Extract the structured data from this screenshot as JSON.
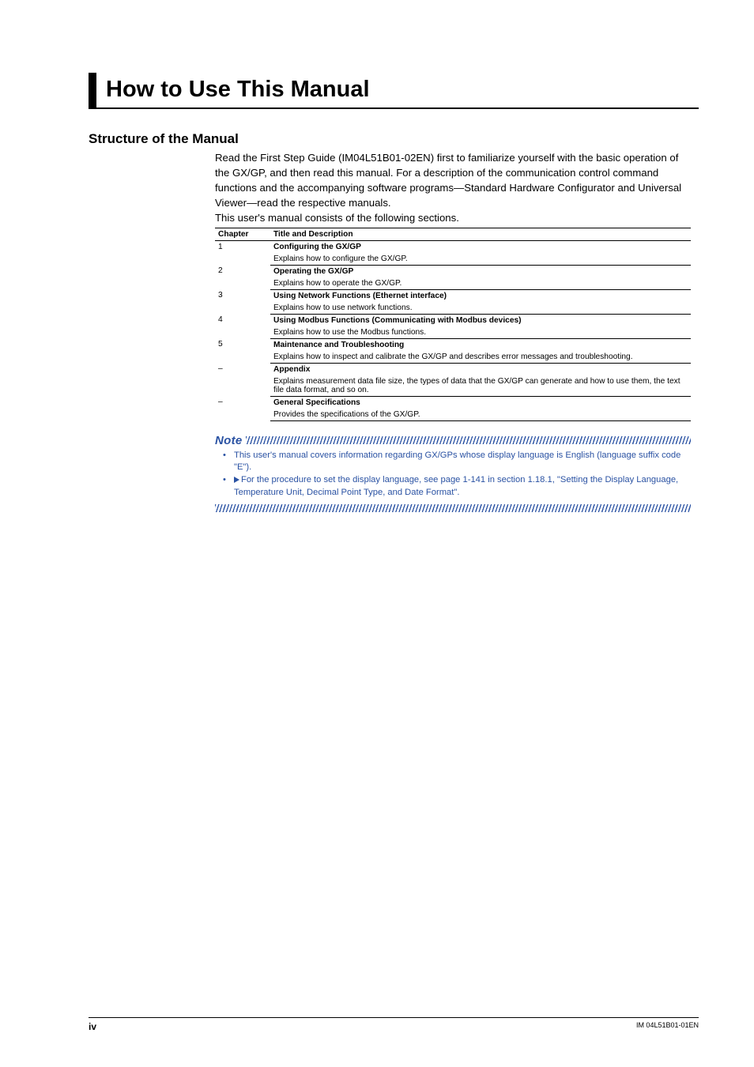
{
  "title": "How to Use This Manual",
  "section_heading": "Structure of the Manual",
  "intro": "Read the First Step Guide (IM04L51B01-02EN) first to familiarize yourself with the basic operation of the GX/GP, and then read this manual. For a description of the communication control command functions and the accompanying software programs—Standard Hardware Configurator and Universal Viewer—read the respective manuals.",
  "intro2": "This user's manual consists of the following sections.",
  "table": {
    "head_chapter": "Chapter",
    "head_title": "Title and Description",
    "rows": [
      {
        "ch": "1",
        "title": "Configuring the GX/GP",
        "desc": "Explains how to configure the GX/GP."
      },
      {
        "ch": "2",
        "title": "Operating the GX/GP",
        "desc": "Explains how to operate the GX/GP."
      },
      {
        "ch": "3",
        "title": "Using Network Functions (Ethernet interface)",
        "desc": "Explains how to use network functions."
      },
      {
        "ch": "4",
        "title": "Using Modbus Functions (Communicating with Modbus devices)",
        "desc": "Explains how to use the Modbus functions."
      },
      {
        "ch": "5",
        "title": "Maintenance and Troubleshooting",
        "desc": "Explains how to inspect and calibrate the GX/GP and describes error messages and troubleshooting."
      },
      {
        "ch": "–",
        "title": "Appendix",
        "desc": "Explains measurement data file size, the types of data that the GX/GP can generate and how to use them, the text file data format, and so on."
      },
      {
        "ch": "–",
        "title": "General Specifications",
        "desc": "Provides the specifications of the GX/GP."
      }
    ]
  },
  "note_label": "Note",
  "notes": [
    {
      "text": "This user's manual covers information regarding GX/GPs whose display language is English (language suffix code \"E\")."
    },
    {
      "leader": "For the procedure to set the display language, see page 1-141 in section 1.18.1, \"Setting the Display Language, Temperature Unit, Decimal Point Type, and Date Format\"."
    }
  ],
  "footer": {
    "page": "iv",
    "doc": "IM 04L51B01-01EN"
  }
}
